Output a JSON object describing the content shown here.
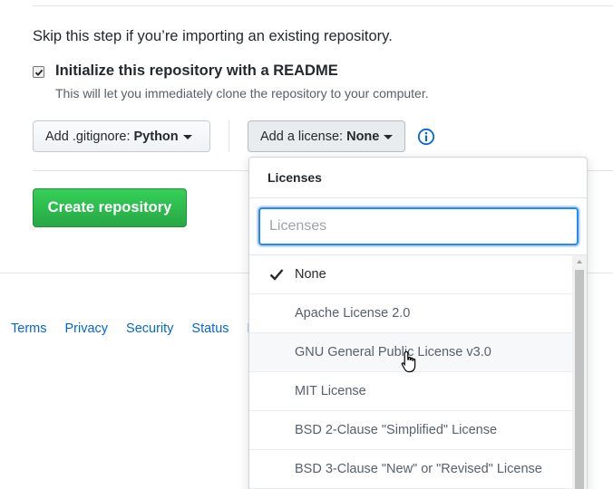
{
  "skip_text": "Skip this step if you’re importing an existing repository.",
  "init": {
    "label": "Initialize this repository with a README",
    "help": "This will let you immediately clone the repository to your computer.",
    "checked": true
  },
  "gitignore": {
    "prefix": "Add .gitignore:",
    "value": "Python"
  },
  "license": {
    "prefix": "Add a license:",
    "value": "None"
  },
  "info_icon": "info-icon",
  "create_button": "Create repository",
  "footer_links": [
    "Terms",
    "Privacy",
    "Security",
    "Status",
    "H"
  ],
  "license_dropdown": {
    "header": "Licenses",
    "filter_placeholder": "Licenses",
    "items": [
      {
        "label": "None",
        "selected": true
      },
      {
        "label": "Apache License 2.0"
      },
      {
        "label": "GNU General Public License v3.0",
        "hovered": true
      },
      {
        "label": "MIT License"
      },
      {
        "label": "BSD 2-Clause \"Simplified\" License"
      },
      {
        "label": "BSD 3-Clause \"New\" or \"Revised\" License"
      }
    ]
  },
  "colors": {
    "accent_green": "#28a745",
    "link_blue": "#0366d6",
    "focus_blue": "#2188ff"
  }
}
